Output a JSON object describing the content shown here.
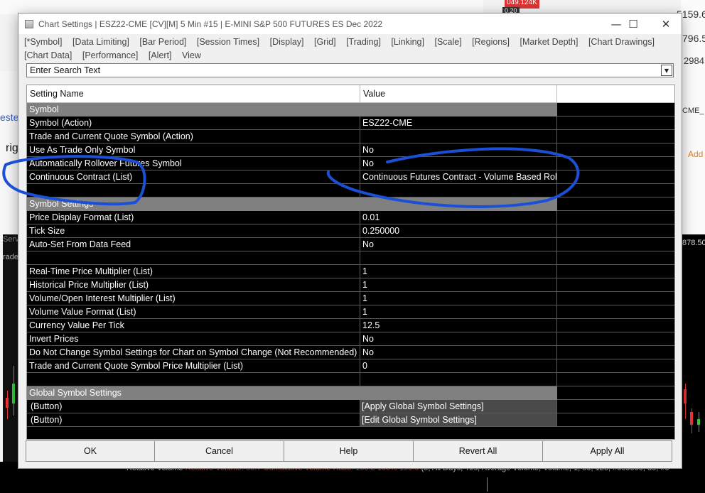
{
  "background": {
    "price_labels": [
      "5159.6",
      "796.5",
      "2984"
    ],
    "left_labels": [
      "este",
      "rig",
      "Serv",
      "rade"
    ],
    "right_labels": [
      "CME_",
      "Add"
    ],
    "right_price": "878.50",
    "top_badge": "049.124K",
    "top_badge2": "0.20",
    "status_line": {
      "prefix": "Relative Volume",
      "highlight": "Relative Volume: 55.7 Cumulative Volume Ratio: 100.2 100% 100.0",
      "rest": "(5, All Days, Yes, Average Volume, Volume, 1, 50, 120, #000000, 80, #0"
    }
  },
  "dialog": {
    "title": "Chart Settings | ESZ22-CME [CV][M]  5 Min  #15 | E-MINI S&P 500 FUTURES ES Dec 2022",
    "window_buttons": {
      "minimize": "—",
      "maximize": "☐",
      "close": "✕"
    },
    "menu": [
      "[*Symbol]",
      "[Data Limiting]",
      "[Bar Period]",
      "[Session Times]",
      "[Display]",
      "[Grid]",
      "[Trading]",
      "[Linking]",
      "[Scale]",
      "[Regions]",
      "[Market Depth]",
      "[Chart Drawings]",
      "[Chart Data]",
      "[Performance]",
      "[Alert]",
      "View"
    ],
    "search": {
      "value": "Enter Search Text"
    },
    "columns": {
      "name": "Setting Name",
      "value": "Value"
    },
    "rows": [
      {
        "type": "section",
        "name": "Symbol",
        "value": ""
      },
      {
        "type": "row",
        "name": "Symbol (Action)",
        "value": "ESZ22-CME"
      },
      {
        "type": "row",
        "name": "Trade and Current Quote Symbol (Action)",
        "value": ""
      },
      {
        "type": "row",
        "name": "Use As Trade Only Symbol",
        "value": "No"
      },
      {
        "type": "row",
        "name": "Automatically Rollover Futures Symbol",
        "value": "No"
      },
      {
        "type": "row",
        "name": "Continuous Contract (List)",
        "value": "Continuous Futures Contract - Volume Based Rollover"
      },
      {
        "type": "blank",
        "name": "",
        "value": ""
      },
      {
        "type": "section",
        "name": "Symbol Settings",
        "value": ""
      },
      {
        "type": "row",
        "name": "Price Display Format (List)",
        "value": "0.01"
      },
      {
        "type": "row",
        "name": "Tick Size",
        "value": "0.250000"
      },
      {
        "type": "row",
        "name": "Auto-Set From Data Feed",
        "value": "No"
      },
      {
        "type": "blank",
        "name": "",
        "value": ""
      },
      {
        "type": "row",
        "name": "Real-Time Price Multiplier (List)",
        "value": "1"
      },
      {
        "type": "row",
        "name": "Historical Price Multiplier (List)",
        "value": "1"
      },
      {
        "type": "row",
        "name": "Volume/Open Interest Multiplier (List)",
        "value": "1"
      },
      {
        "type": "row",
        "name": "Volume Value Format (List)",
        "value": "1"
      },
      {
        "type": "row",
        "name": "Currency Value Per Tick",
        "value": "12.5"
      },
      {
        "type": "row",
        "name": "Invert Prices",
        "value": "No"
      },
      {
        "type": "row",
        "name": "Do Not Change Symbol Settings for Chart on Symbol Change (Not Recommended)",
        "value": "No"
      },
      {
        "type": "row",
        "name": "Trade and Current Quote Symbol Price Multiplier (List)",
        "value": "0"
      },
      {
        "type": "blank",
        "name": "",
        "value": ""
      },
      {
        "type": "section",
        "name": "Global Symbol Settings",
        "value": ""
      },
      {
        "type": "button",
        "name": "(Button)",
        "value": "[Apply Global Symbol Settings]"
      },
      {
        "type": "button",
        "name": "(Button)",
        "value": "[Edit Global Symbol Settings]"
      }
    ],
    "buttons": {
      "ok": "OK",
      "cancel": "Cancel",
      "help": "Help",
      "revert_all": "Revert All",
      "apply_all": "Apply All"
    }
  },
  "colors": {
    "grid_background": "#000000",
    "section_row": "#808080",
    "annotation_stroke": "#1a4fd6"
  }
}
